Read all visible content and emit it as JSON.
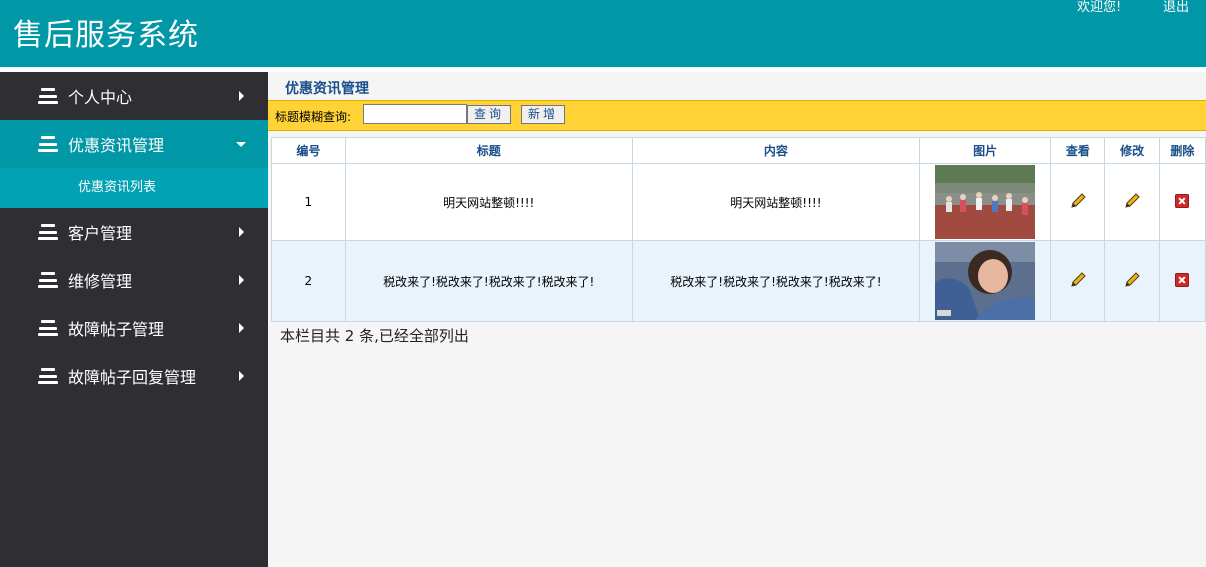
{
  "header": {
    "title": "售后服务系统",
    "welcome": "欢迎您!",
    "logout": "退出"
  },
  "sidebar": {
    "items": [
      {
        "label": "个人中心",
        "icon": "stack-icon",
        "arrow": "right"
      },
      {
        "label": "优惠资讯管理",
        "icon": "stack-icon",
        "arrow": "down",
        "active": true,
        "subitems": [
          {
            "label": "优惠资讯列表"
          }
        ]
      },
      {
        "label": "客户管理",
        "icon": "stack-icon",
        "arrow": "right"
      },
      {
        "label": "维修管理",
        "icon": "stack-icon",
        "arrow": "right"
      },
      {
        "label": "故障帖子管理",
        "icon": "stack-icon",
        "arrow": "right"
      },
      {
        "label": "故障帖子回复管理",
        "icon": "stack-icon",
        "arrow": "right"
      }
    ]
  },
  "main": {
    "page_title": "优惠资讯管理",
    "search": {
      "label": "标题模糊查询:",
      "value": "",
      "query_button": "查询",
      "add_button": "新增"
    },
    "table": {
      "headers": [
        "编号",
        "标题",
        "内容",
        "图片",
        "查看",
        "修改",
        "删除"
      ],
      "rows": [
        {
          "id": "1",
          "title": "明天网站整顿!!!!",
          "content": "明天网站整顿!!!!",
          "image": "children-playground-photo"
        },
        {
          "id": "2",
          "title": "税改来了!税改来了!税改来了!税改来了!",
          "content": "税改来了!税改来了!税改来了!税改来了!",
          "image": "people-hugging-photo"
        }
      ]
    },
    "footer_text": "本栏目共 2 条,已经全部列出"
  },
  "colors": {
    "header": "#0097a7",
    "sidebar": "#2e2e33",
    "active_nav": "#0097a7",
    "search_bar": "#ffd236",
    "table_header_text": "#1a4f8b"
  }
}
